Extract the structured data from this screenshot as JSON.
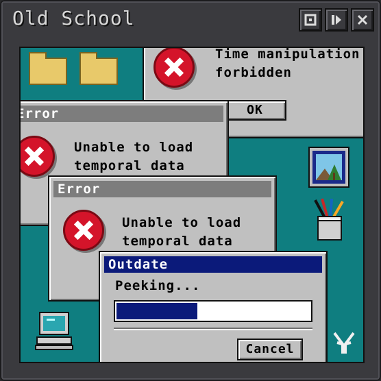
{
  "window": {
    "title": "Old School",
    "buttons": [
      "maximize-icon",
      "play-icon",
      "close-icon"
    ]
  },
  "dialogs": {
    "top": {
      "message_line1": "Time manipulation",
      "message_line2": "forbidden",
      "ok_label": "OK"
    },
    "middle": {
      "title": "Error",
      "message_line1": "Unable to load",
      "message_line2": "temporal data"
    },
    "front_error": {
      "title": "Error",
      "message_line1": "Unable to load",
      "message_line2": "temporal data"
    },
    "progress": {
      "title": "Outdate",
      "status": "Peeking...",
      "cancel_label": "Cancel",
      "progress_fraction": 0.42
    }
  },
  "icons": [
    "folder-icon",
    "folder-icon",
    "picture-icon",
    "pencil-cup-icon",
    "computer-icon",
    "logo-icon"
  ],
  "colors": {
    "desktop": "#0f7e80",
    "active_title": "#0b1a7a",
    "inactive_title": "#7d7d7d",
    "error_red": "#d4142a"
  }
}
